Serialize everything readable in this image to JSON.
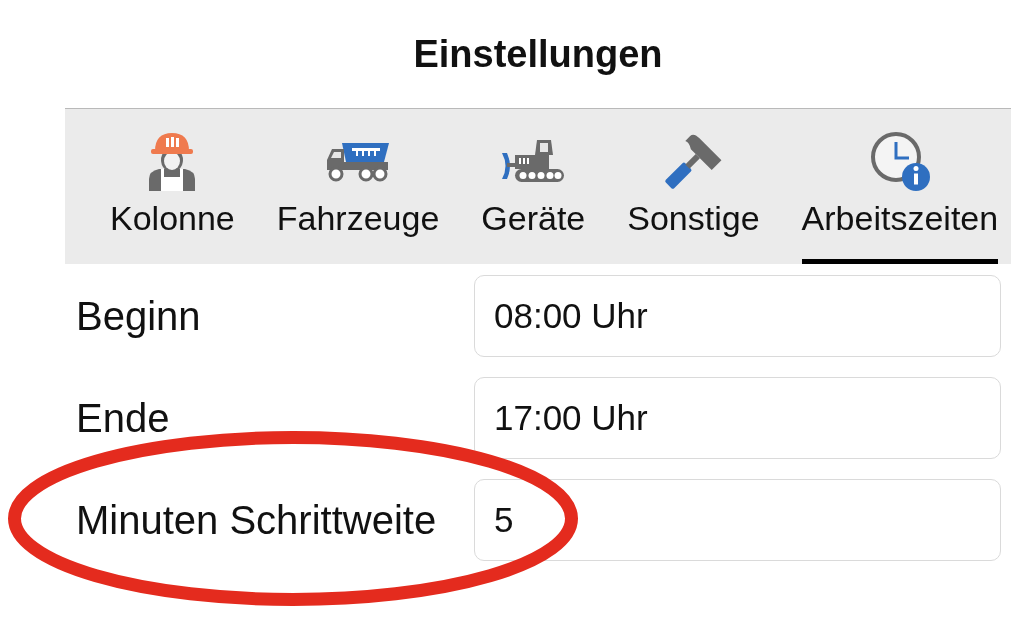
{
  "title": "Einstellungen",
  "tabs": [
    {
      "label": "Kolonne",
      "kind": "worker",
      "selected": false
    },
    {
      "label": "Fahrzeuge",
      "kind": "truck",
      "selected": false
    },
    {
      "label": "Geräte",
      "kind": "bulldozer",
      "selected": false
    },
    {
      "label": "Sonstige",
      "kind": "hammer",
      "selected": false
    },
    {
      "label": "Arbeitszeiten",
      "kind": "clock",
      "selected": true
    }
  ],
  "rows": [
    {
      "label": "Beginn",
      "value": "08:00 Uhr",
      "highlighted": false
    },
    {
      "label": "Ende",
      "value": "17:00 Uhr",
      "highlighted": false
    },
    {
      "label": "Minuten Schrittweite",
      "value": "5",
      "highlighted": true
    }
  ]
}
